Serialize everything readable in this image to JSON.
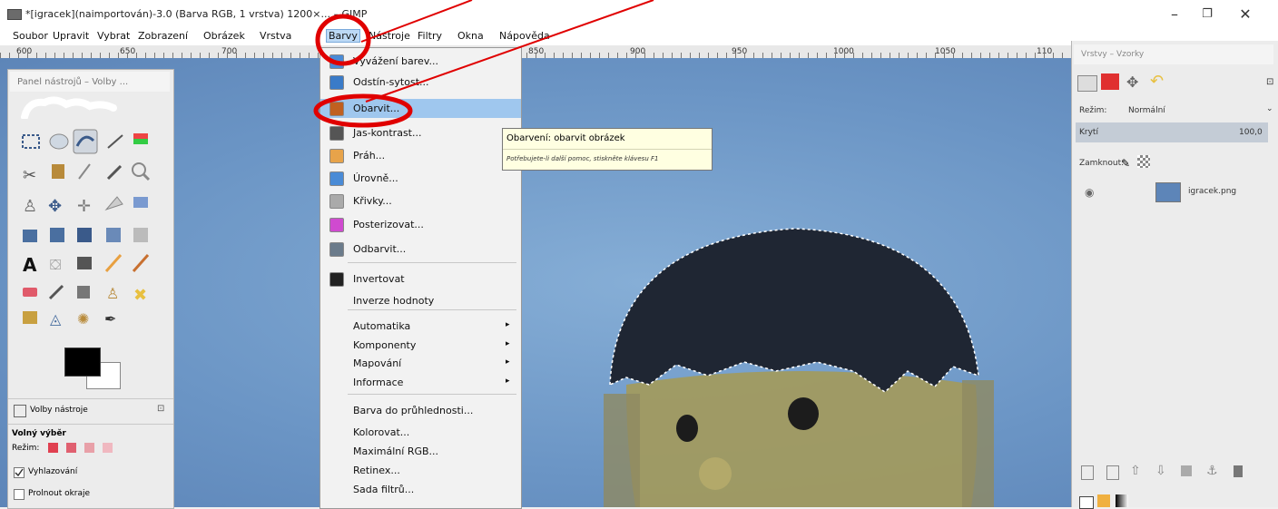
{
  "window": {
    "title": "*[igracek](naimportován)-3.0 (Barva RGB, 1 vrstva) 1200×... – GIMP",
    "controls": {
      "minimize": "–",
      "maximize": "❐",
      "close": "✕"
    }
  },
  "menubar": {
    "items": [
      "Soubor",
      "Upravit",
      "Vybrat",
      "Zobrazení",
      "Obrázek",
      "Vrstva",
      "Barvy",
      "Nástroje",
      "Filtry",
      "Okna",
      "Nápověda"
    ],
    "active": "Barvy"
  },
  "ruler": {
    "ticks": [
      "600",
      "650",
      "700",
      "850",
      "900",
      "950",
      "1000",
      "1050",
      "110"
    ]
  },
  "toolbox": {
    "title": "Panel nástrojů – Volby ...",
    "tab_label": "Volby nástroje",
    "tool_name": "Volný výběr",
    "mode_label": "Režim:",
    "options": [
      {
        "label": "Vyhlazování",
        "checked": true
      },
      {
        "label": "Prolnout okraje",
        "checked": false
      }
    ]
  },
  "colors_menu": {
    "items": [
      {
        "label": "Vyvážení barev...",
        "icon": "color-balance-icon",
        "color": "#4a8bd6"
      },
      {
        "label": "Odstín-sytost...",
        "icon": "hue-saturation-icon",
        "color": "#3a7bc8"
      },
      {
        "label": "Obarvit...",
        "icon": "colorize-icon",
        "color": "#c06020",
        "highlighted": true
      },
      {
        "label": "Jas-kontrast...",
        "icon": "brightness-contrast-icon",
        "color": "#555555"
      },
      {
        "label": "Práh...",
        "icon": "threshold-icon",
        "color": "#e7a34a"
      },
      {
        "label": "Úrovně...",
        "icon": "levels-icon",
        "color": "#4a8bd6"
      },
      {
        "label": "Křivky...",
        "icon": "curves-icon",
        "color": "#aaaaaa"
      },
      {
        "label": "Posterizovat...",
        "icon": "posterize-icon",
        "color": "#d04ad0"
      },
      {
        "label": "Odbarvit...",
        "icon": "desaturate-icon",
        "color": "#6b7b8b"
      },
      {
        "label": "Invertovat",
        "icon": "invert-icon",
        "color": "#222222"
      },
      {
        "label": "Inverze hodnoty",
        "icon": "",
        "color": ""
      },
      {
        "label": "Automatika",
        "icon": "",
        "color": "",
        "submenu": true
      },
      {
        "label": "Komponenty",
        "icon": "",
        "color": "",
        "submenu": true
      },
      {
        "label": "Mapování",
        "icon": "",
        "color": "",
        "submenu": true
      },
      {
        "label": "Informace",
        "icon": "",
        "color": "",
        "submenu": true
      },
      {
        "label": "Barva do průhlednosti...",
        "icon": "",
        "color": ""
      },
      {
        "label": "Kolorovat...",
        "icon": "",
        "color": ""
      },
      {
        "label": "Maximální RGB...",
        "icon": "",
        "color": ""
      },
      {
        "label": "Retinex...",
        "icon": "",
        "color": ""
      },
      {
        "label": "Sada filtrů...",
        "icon": "",
        "color": ""
      }
    ],
    "submenu_arrow": "▸"
  },
  "tooltip": {
    "title": "Obarvení: obarvit obrázek",
    "hint": "Potřebujete-li další pomoc, stiskněte klávesu F1"
  },
  "layers_panel": {
    "title": "Vrstvy – Vzorky",
    "mode_label": "Režim:",
    "mode_value": "Normální",
    "opacity_label": "Krytí",
    "opacity_value": "100,0",
    "lock_label": "Zamknout:",
    "layer_name": "igracek.png"
  },
  "colors": {
    "accent": "#9fc7ee",
    "annotation": "#e00000",
    "canvas": "#6b95c5"
  }
}
